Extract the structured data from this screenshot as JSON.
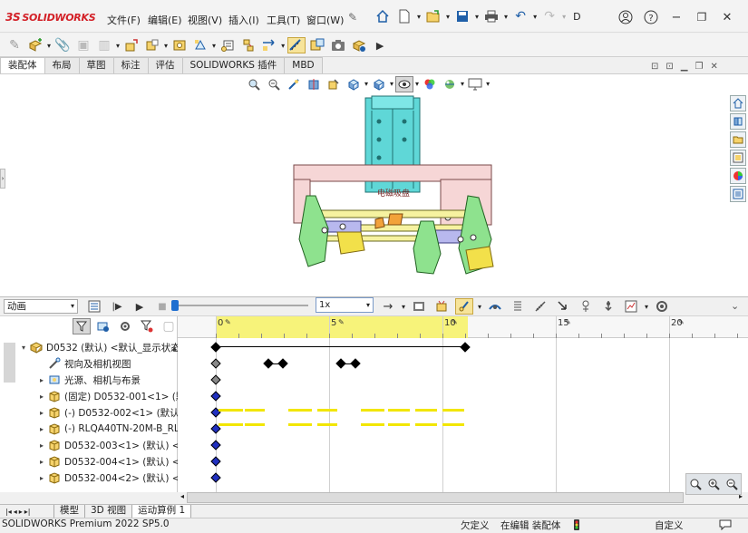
{
  "app": {
    "logo_text": "SOLIDWORKS",
    "logo_mark": "3S"
  },
  "menu": [
    "文件(F)",
    "编辑(E)",
    "视图(V)",
    "插入(I)",
    "工具(T)",
    "窗口(W)"
  ],
  "search_hint": "D",
  "command_tabs": [
    {
      "label": "装配体",
      "active": true
    },
    {
      "label": "布局",
      "active": false
    },
    {
      "label": "草图",
      "active": false
    },
    {
      "label": "标注",
      "active": false
    },
    {
      "label": "评估",
      "active": false
    },
    {
      "label": "SOLIDWORKS 插件",
      "active": false
    },
    {
      "label": "MBD",
      "active": false
    }
  ],
  "model_label": "电磁吸盘",
  "motion": {
    "study_type": "动画",
    "speed": "1x",
    "time_ticks": [
      "0",
      "5",
      "10",
      "15",
      "20"
    ],
    "tree": [
      {
        "label": "D0532 (默认) <默认_显示状态",
        "expand": "down",
        "icon": "assembly",
        "indent": 0
      },
      {
        "label": "视向及相机视图",
        "expand": "",
        "icon": "camera",
        "indent": 1
      },
      {
        "label": "光源、相机与布景",
        "expand": "right",
        "icon": "light",
        "indent": 1
      },
      {
        "label": "(固定) D0532-001<1> (默",
        "expand": "right",
        "icon": "part",
        "indent": 1
      },
      {
        "label": "(-) D0532-002<1> (默认)",
        "expand": "right",
        "icon": "part",
        "indent": 1
      },
      {
        "label": "(-) RLQA40TN-20M-B_RL",
        "expand": "right",
        "icon": "part",
        "indent": 1
      },
      {
        "label": "D0532-003<1> (默认) <",
        "expand": "right",
        "icon": "part",
        "indent": 1
      },
      {
        "label": "D0532-004<1> (默认) <",
        "expand": "right",
        "icon": "part",
        "indent": 1
      },
      {
        "label": "D0532-004<2> (默认) <",
        "expand": "right",
        "icon": "part",
        "indent": 1
      }
    ]
  },
  "bottom_tabs": [
    {
      "label": "模型",
      "active": false
    },
    {
      "label": "3D 视图",
      "active": false
    },
    {
      "label": "运动算例 1",
      "active": true
    }
  ],
  "status": {
    "version": "SOLIDWORKS Premium 2022 SP5.0",
    "constraint": "欠定义",
    "editing": "在编辑 装配体",
    "units": "自定义"
  },
  "colors": {
    "accent": "#1f5fa8",
    "timeline_yellow": "#f7f37a",
    "key_blue": "#2030c0",
    "cylinder": "#5fd7d7",
    "frame": "#f6d6d6",
    "arm": "#8ee28e",
    "pad": "#f2e04a"
  }
}
